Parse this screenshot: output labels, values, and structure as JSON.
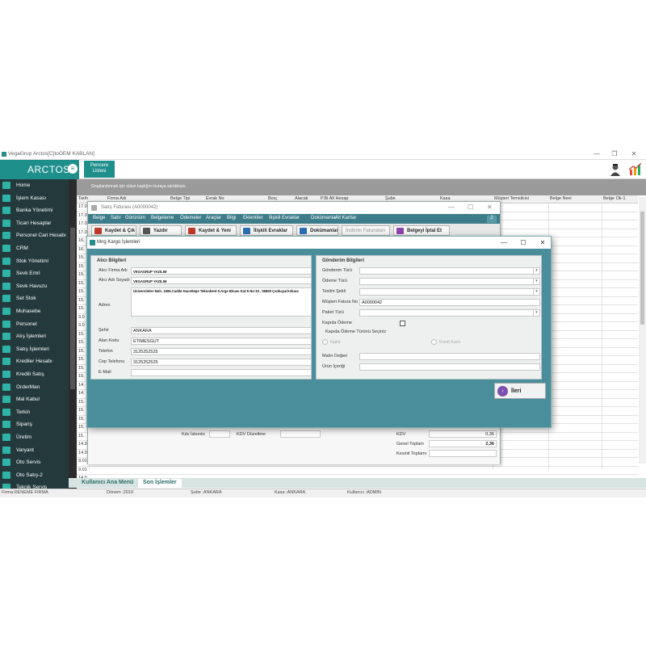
{
  "window": {
    "title": "VegaGrup Arctos[C]toOEM KABLAN]",
    "controls": [
      "—",
      "❐",
      "✕"
    ]
  },
  "toolbar": {
    "brand": "ARCTOS",
    "window_button": "Pencere Listesi"
  },
  "sidebar": {
    "items": [
      "Home",
      "İşlem Kasası",
      "Banka Yönetimi",
      "Ticari Hesaplar",
      "Personel Cari Hesabı",
      "CRM",
      "Stok Yönetimi",
      "Sevk Emri",
      "Sevk Havuzu",
      "Set Stok",
      "Muhasebe",
      "Personel",
      "Alış İşlemleri",
      "Satış İşlemleri",
      "Krediler Hesabı",
      "Kredili Satış",
      "OrderMan",
      "Mal Kabul",
      "Terkin",
      "Sipariş",
      "Üretim",
      "Varyant",
      "Oto Servis",
      "Oto Satış-2",
      "Teknik Servis"
    ]
  },
  "grid": {
    "group_hint": "Gruplandırmak için sütun başlığını buraya sürükleyin.",
    "headers": [
      "Tarih",
      "Firma Adı",
      "Belge Tipi",
      "Evrak No",
      "Borç",
      "Alacak",
      "P.Bi Alt Hesap",
      "Şube",
      "Kasa",
      "Müşteri Temsilcisi",
      "Belge Nevi",
      "Belge Ok-1"
    ],
    "dates": [
      "17.0",
      "17.0",
      "17.0",
      "17.0",
      "16.",
      "16.",
      "15.",
      "15.",
      "15.",
      "15.",
      "15.",
      "15.",
      "15.",
      "3.0",
      "3.0",
      "15.",
      "15.",
      "15.",
      "15.",
      "15.",
      "15.",
      "14.",
      "14.",
      "15.",
      "15.",
      "15.",
      "15.",
      "15.",
      "14.0",
      "14.0",
      "9.01",
      "9.01",
      "14.0",
      "14.0"
    ]
  },
  "bottom_tabs": [
    "Kullanıcı Ana Menü",
    "Son İşlemler"
  ],
  "status": [
    "Firma:DENEME FIRMA",
    "Dönem :2019",
    "Şube :ANKARA",
    "Kasa :ANKARA",
    "Kullanıcı :ADMIN"
  ],
  "invoice": {
    "title": "Satış Faturası (A0000042)",
    "menu": [
      "Belge",
      "Satır",
      "Görünüm",
      "Belgeleme",
      "Ödemeler",
      "Araçlar",
      "Bilgi",
      "Eklentiler",
      "İlişkili Evraklar",
      "Dokümanlar",
      "Alt Kartlar"
    ],
    "badge": "2",
    "tools": [
      "Kaydet & Çık",
      "Yazdır",
      "Kaydet & Yeni",
      "İlişkili Evraklar",
      "Dokümanlar",
      "İndirim Faturaları",
      "Belgeyi İptal Et"
    ],
    "kdv_label": "Kdv İskonto",
    "kdv_dus_label": "KDV Düzeltme",
    "totals": [
      {
        "label": "KDV",
        "value": "0,36"
      },
      {
        "label": "Genel Toplam",
        "value": "2,36"
      },
      {
        "label": "Kesinti Toplamı",
        "value": ""
      }
    ]
  },
  "cargo": {
    "title": "Mng Kargo İşlemleri",
    "receiver": {
      "title": "Alıcı Bilgileri",
      "firma_label": "Alıcı Firma Adı",
      "firma": "VEGAGRUP YAZILIM",
      "adsoyad_label": "Alıcı Adı Soyadı",
      "adsoyad": "VEGAGRUP YAZILIM",
      "adres_label": "Adres",
      "adres": "Üniversiteler Mah. 1606.Cadde Hacettepe Teknokent 5.Arge Binası Kat:5 No:19 , 06800 Çankaya/Ankara",
      "sehir_label": "Şehir",
      "sehir": "ANKARA",
      "alan_label": "Alan Kodu",
      "alan": "ETIMESGUT",
      "telefon_label": "Telefon",
      "telefon": "3125252525",
      "cep_label": "Cep Telefonu",
      "cep": "3125252525",
      "email_label": "E-Mail",
      "email": ""
    },
    "sender": {
      "title": "Gönderim Bilgileri",
      "gonderim_turu": "Gönderim Türü",
      "odeme_turu": "Ödeme Türü",
      "teslim_sekli": "Teslim Şekli",
      "fatura_no_label": "Müşteri Fatura No",
      "fatura_no": "A0000042",
      "paket_turu": "Paket Türü",
      "kapida_odeme": "Kapıda Ödeme",
      "kapida_odeme_turu": "Kapıda Ödeme Türünü Seçiniz",
      "nakit": "Nakit",
      "kredi_karti": "Kredi Kartı",
      "malin_degeri": "Malın Değeri",
      "urun_icerigi": "Ürün İçeriği"
    },
    "next_button": "İleri"
  },
  "colors": {
    "accent": "#1f8f8c",
    "sidebar": "#23393c",
    "dialog": "#4a8e9b"
  }
}
